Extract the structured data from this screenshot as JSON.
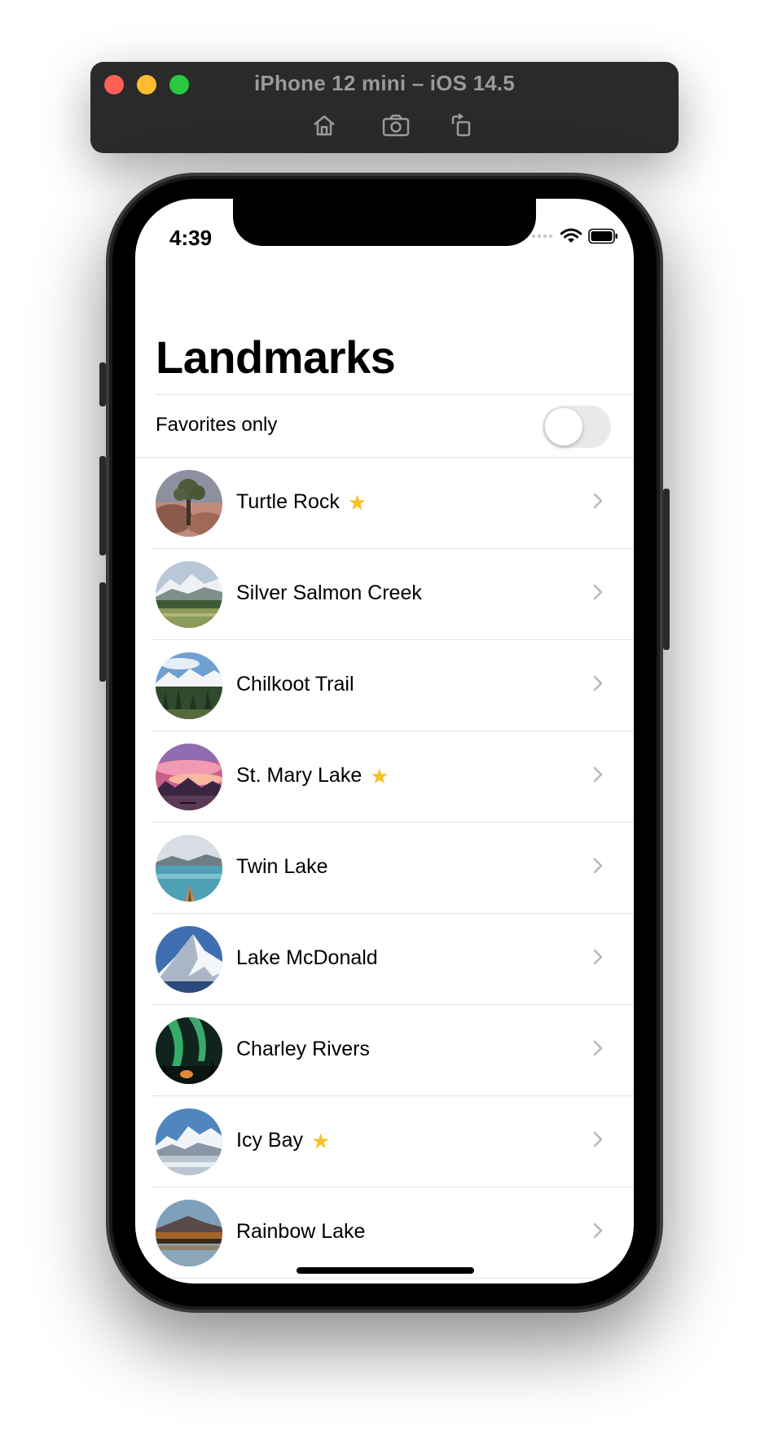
{
  "simulator": {
    "title": "iPhone 12 mini – iOS 14.5",
    "buttons": [
      "home-icon",
      "screenshot-icon",
      "rotate-icon"
    ],
    "traffic_lights": {
      "close": "#fe5f57",
      "minimize": "#febc2e",
      "zoom": "#28c840"
    }
  },
  "status_bar": {
    "time": "4:39"
  },
  "page": {
    "title": "Landmarks"
  },
  "filter": {
    "label": "Favorites only",
    "on": false
  },
  "landmarks": [
    {
      "name": "Turtle Rock",
      "favorite": true
    },
    {
      "name": "Silver Salmon Creek",
      "favorite": false
    },
    {
      "name": "Chilkoot Trail",
      "favorite": false
    },
    {
      "name": "St. Mary Lake",
      "favorite": true
    },
    {
      "name": "Twin Lake",
      "favorite": false
    },
    {
      "name": "Lake McDonald",
      "favorite": false
    },
    {
      "name": "Charley Rivers",
      "favorite": false
    },
    {
      "name": "Icy Bay",
      "favorite": true
    },
    {
      "name": "Rainbow Lake",
      "favorite": false
    }
  ],
  "colors": {
    "star": "#f7c124",
    "chevron": "#c4c4c7",
    "toggle_off": "#e9e9eb"
  }
}
